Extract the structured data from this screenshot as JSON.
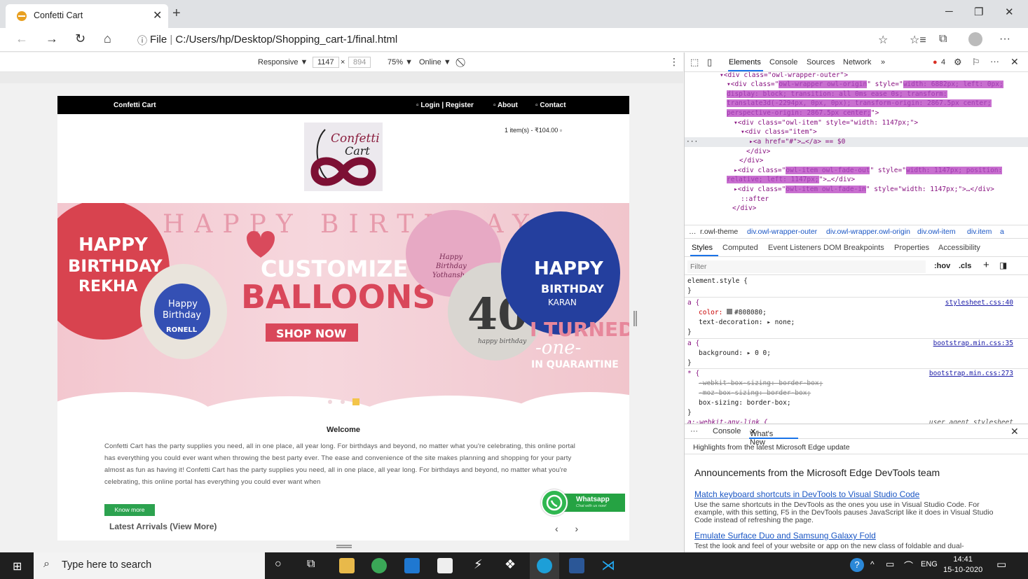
{
  "browser": {
    "tab_title": "Confetti Cart",
    "url_prefix": "File",
    "url": "C:/Users/hp/Desktop/Shopping_cart-1/final.html"
  },
  "device_toolbar": {
    "mode": "Responsive ▼",
    "width": "1147",
    "height": "894",
    "zoom": "75% ▼",
    "network": "Online ▼"
  },
  "site": {
    "brand": "Confetti Cart",
    "nav": [
      "Login | Register",
      "About",
      "Contact"
    ],
    "logo_line1": "Confetti",
    "logo_line2": "Cart",
    "cart": "1 item(s) - ₹104.00",
    "hero": {
      "banner_text": "HAPPY BIRTHDAY",
      "b1": [
        "HAPPY",
        "BIRTHDAY",
        "REKHA"
      ],
      "b2": [
        "Happy",
        "Birthday",
        "RONELL"
      ],
      "customize": "CUSTOMIZE",
      "balloons": "BALLOONS",
      "shop_now": "SHOP NOW",
      "b3": [
        "Happy",
        "Birthday",
        "Yothansh"
      ],
      "b4": [
        "40",
        "happy birthday"
      ],
      "b5": [
        "HAPPY",
        "BIRTHDAY",
        "KARAN"
      ],
      "turned": "I TURNED",
      "one": "-one-",
      "quarantine": "IN QUARANTINE"
    },
    "welcome_title": "Welcome",
    "welcome_text": "Confetti Cart has the party supplies you need, all in one place, all year long. For birthdays and beyond, no matter what you're celebrating, this online portal has everything you could ever want when throwing the best party ever. The ease and convenience of the site makes planning and shopping for your party almost as fun as having it! Confetti Cart has the party supplies you need, all in one place, all year long. For birthdays and beyond, no matter what you're celebrating, this online portal has everything you could ever want when",
    "know_more": "Know more",
    "latest": "Latest Arrivals (View More)",
    "whatsapp": "Whatsapp",
    "whatsapp_sub": "Chat with us now!"
  },
  "devtools": {
    "tabs": [
      "Elements",
      "Console",
      "Sources",
      "Network",
      "»"
    ],
    "error_count": "4",
    "dom_lines": [
      "<div class=\"owl-wrapper-outer\">",
      "<div class=\"",
      "owl-wrapper owl-origin",
      "\" style=\"",
      "width: 6882px; left: 0px;",
      "display: block; transition: all 0ms ease 0s; transform:",
      "translate3d(-2294px, 0px, 0px); transform-origin: 2867.5px center;",
      "perspective-origin: 2867.5px center;",
      "\">",
      "<div class=\"owl-item\" style=\"width: 1147px;\">",
      "<div class=\"item\">",
      "<a href=\"#\">…</a> == $0",
      "</div>",
      "</div>",
      "<div class=\"",
      "owl-item owl-fade-out",
      "width: 1147px; position:",
      "relative; left: 1147px;",
      "\">…</div>",
      "owl-item owl-fade-in",
      "\" style=\"width: 1147px;\">…</div>",
      "::after",
      "</div>"
    ],
    "crumbs": [
      "…",
      "r.owl-theme",
      "div.owl-wrapper-outer",
      "div.owl-wrapper.owl-origin",
      "div.owl-item",
      "div.item",
      "a"
    ],
    "style_tabs": [
      "Styles",
      "Computed",
      "Event Listeners",
      "DOM Breakpoints",
      "Properties",
      "Accessibility"
    ],
    "filter_placeholder": "Filter",
    "hov": ":hov",
    "cls": ".cls",
    "rules": {
      "r1": "element.style {",
      "close": "}",
      "r2_sel": "a {",
      "r2_src": "stylesheet.css:40",
      "r2_p1": "color: ",
      "r2_v1": "#808080;",
      "r2_p2": "text-decoration: ▸ none;",
      "r3_src": "bootstrap.min.css:35",
      "r3_p1": "background: ▸ 0 0;",
      "r4_sel": "* {",
      "r4_src": "bootstrap.min.css:273",
      "r4_p1": "-webkit-box-sizing: border-box;",
      "r4_p2": "-moz-box-sizing: border-box;",
      "r4_p3": "box-sizing: border-box;",
      "r5_sel": "a:-webkit-any-link {",
      "r5_src": "user agent stylesheet"
    },
    "drawer_tabs": [
      "Console",
      "What's New"
    ],
    "highlights": "Highlights from the latest Microsoft Edge update",
    "announce_title": "Announcements from the Microsoft Edge DevTools team",
    "a1_title": "Match keyboard shortcuts in DevTools to Visual Studio Code",
    "a1_text": "Use the same shortcuts in the DevTools as the ones you use in Visual Studio Code. For example, with this setting, F5 in the DevTools pauses JavaScript like it does in Visual Studio Code instead of refreshing the page.",
    "a2_title": "Emulate Surface Duo and Samsung Galaxy Fold",
    "a2_text": "Test the look and feel of your website or app on the new class of foldable and dual-"
  },
  "taskbar": {
    "search_placeholder": "Type here to search",
    "lang": "ENG",
    "time": "14:41",
    "date": "15-10-2020"
  },
  "colors": {
    "accent_green": "#2ca24f",
    "nav_black": "#000000",
    "hero_pink": "#f3c7cf",
    "devtools_highlight": "#c86fcf"
  }
}
